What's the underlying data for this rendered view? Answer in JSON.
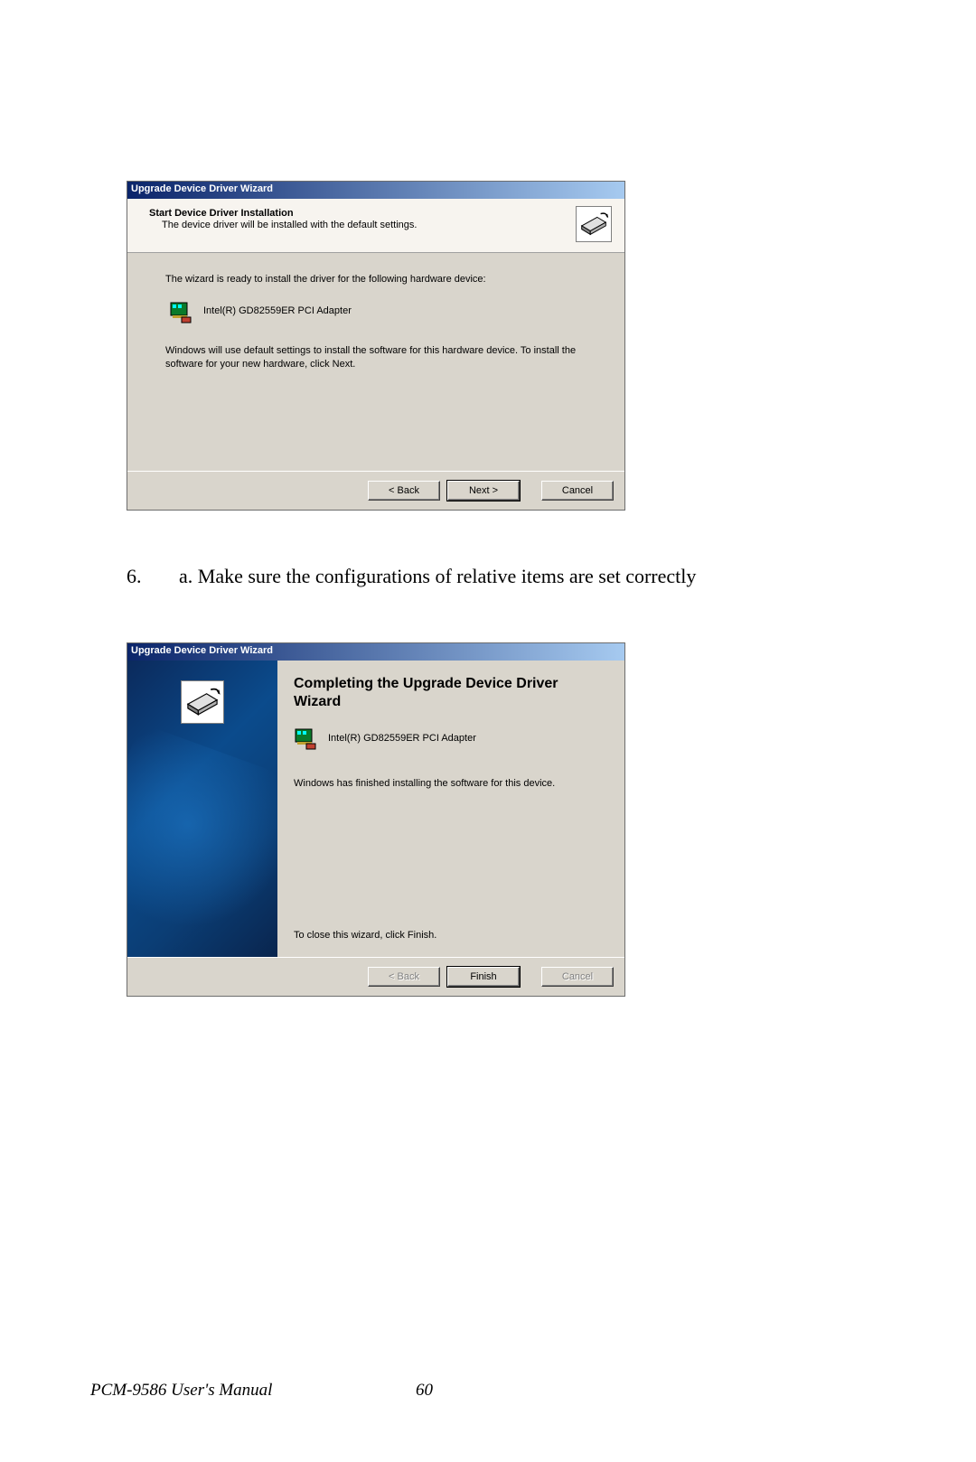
{
  "dialog1": {
    "title": "Upgrade Device Driver Wizard",
    "header_title": "Start Device Driver Installation",
    "header_sub": "The device driver will be installed with the default settings.",
    "body_line1": "The wizard is ready to install the driver for the following hardware device:",
    "device_name": "Intel(R) GD82559ER PCI Adapter",
    "body_line2": "Windows will use default settings to install the software for this hardware device. To install the software for your new hardware, click Next.",
    "back_label": "< Back",
    "next_label": "Next >",
    "cancel_label": "Cancel"
  },
  "instruction": {
    "number": "6.",
    "text": "a. Make sure the configurations of relative items are set correctly"
  },
  "dialog2": {
    "title": "Upgrade Device Driver Wizard",
    "big_title": "Completing the Upgrade Device Driver Wizard",
    "device_name": "Intel(R) GD82559ER PCI Adapter",
    "body_line": "Windows has finished installing the software for this device.",
    "finish_hint": "To close this wizard, click Finish.",
    "back_label": "< Back",
    "finish_label": "Finish",
    "cancel_label": "Cancel"
  },
  "footer": {
    "manual": "PCM-9586 User's Manual",
    "page": "60"
  }
}
